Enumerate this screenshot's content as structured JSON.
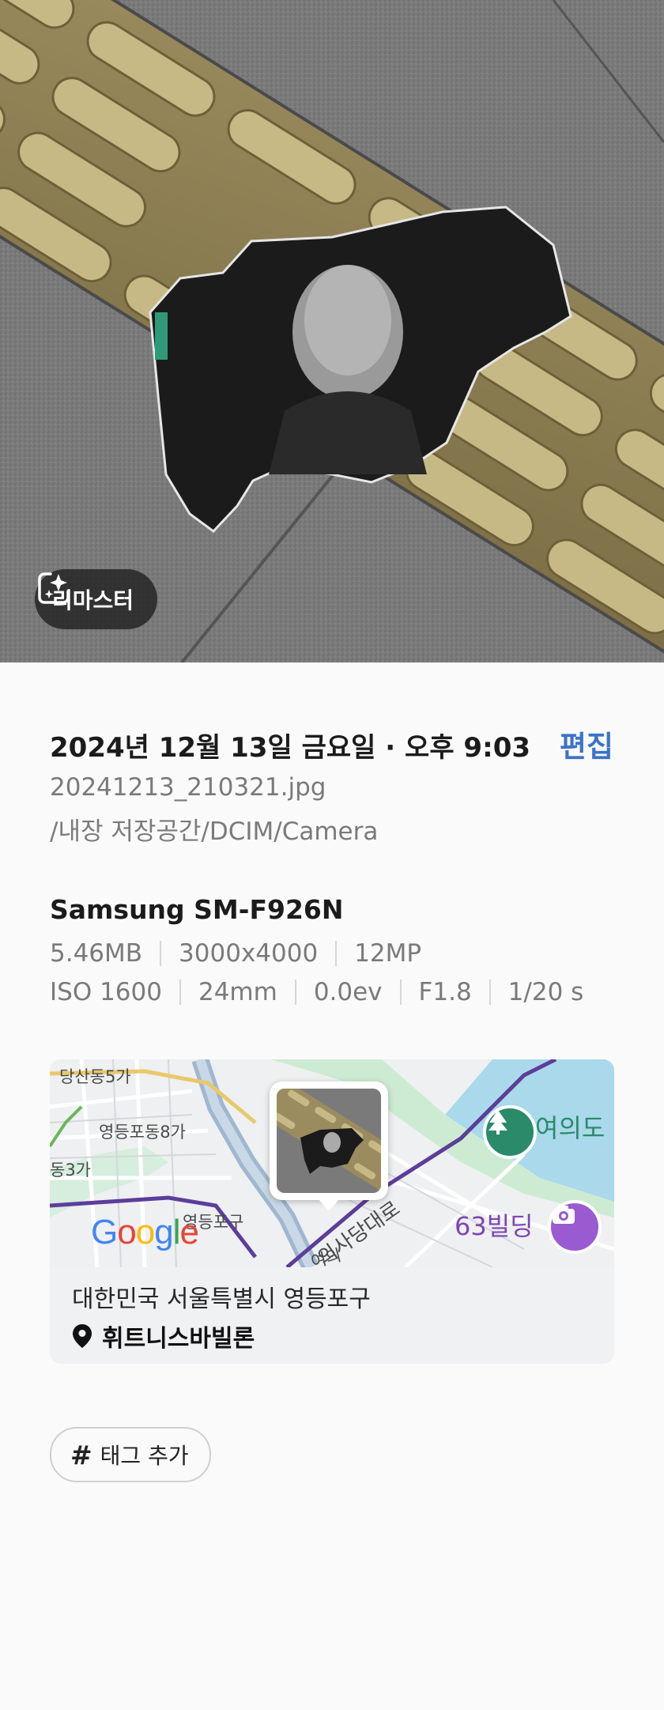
{
  "photo": {
    "remaster_label": "리마스터",
    "remaster_icon": "sparkle-frame-icon"
  },
  "details": {
    "datetime": "2024년 12월 13일 금요일 · 오후 9:03",
    "edit_label": "편집",
    "filename": "20241213_210321.jpg",
    "path": "/내장 저장공간/DCIM/Camera",
    "device": "Samsung SM-F926N",
    "specs_row1": [
      "5.46MB",
      "3000x4000",
      "12MP"
    ],
    "specs_row2": [
      "ISO 1600",
      "24mm",
      "0.0ev",
      "F1.8",
      "1/20 s"
    ]
  },
  "map": {
    "labels": {
      "dangsan": "당산동5가",
      "yeongdeungpo8": "영등포동8가",
      "dong3": "동3가",
      "yeongdeungpogu": "영등포구",
      "uisadang": "의사당대로",
      "yeoui_small": "여의"
    },
    "google": "Google",
    "poi_park": "여의도",
    "poi_63": "63빌딩",
    "address": "대한민국 서울특별시 영등포구",
    "place": "휘트니스바빌론",
    "place_icon": "location-pin-icon",
    "colors": {
      "poi_purple": "#7d45b5",
      "poi_green": "#2a8a6a",
      "water": "#a9d9ea"
    }
  },
  "tag": {
    "symbol": "#",
    "label": "태그 추가"
  }
}
